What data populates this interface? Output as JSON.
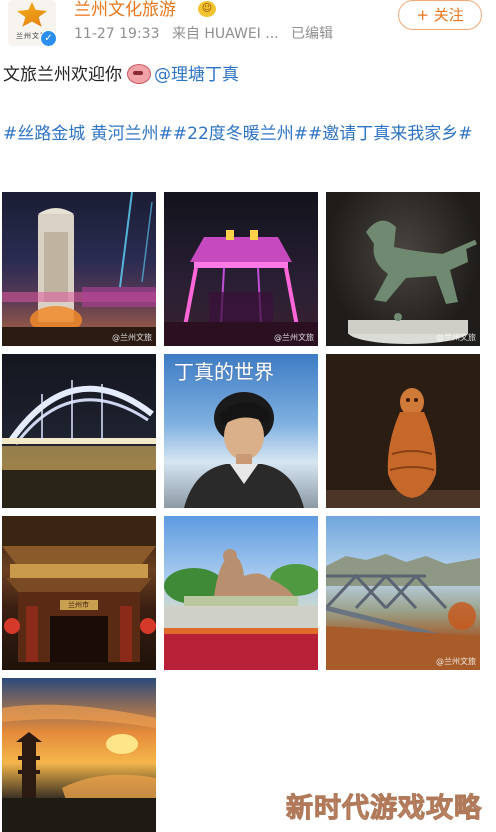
{
  "header": {
    "avatar_text": "兰州文旅",
    "username": "兰州文化旅游",
    "time": "11-27 19:33",
    "source": "来自 HUAWEI ...",
    "edited": "已编辑",
    "follow_label": "+ 关注"
  },
  "post": {
    "text": "文旅兰州欢迎你",
    "mention": "@理塘丁真",
    "hashtags": "#丝路金城 黄河兰州##22度冬暖兰州##邀请丁真来我家乡#"
  },
  "photos": [
    {
      "watermark": "@兰州文旅"
    },
    {
      "watermark": "@兰州文旅"
    },
    {
      "watermark": "@兰州文旅"
    },
    {
      "watermark": ""
    },
    {
      "caption": "丁真的世界"
    },
    {
      "watermark": ""
    },
    {
      "sign": "兰州市"
    },
    {
      "watermark": ""
    },
    {
      "watermark": "@兰州文旅"
    },
    {
      "watermark": ""
    }
  ],
  "site_watermark": "新时代游戏攻略",
  "colors": {
    "accent": "#e8761b",
    "link": "#2f74c4",
    "meta": "#8f8f8f"
  }
}
